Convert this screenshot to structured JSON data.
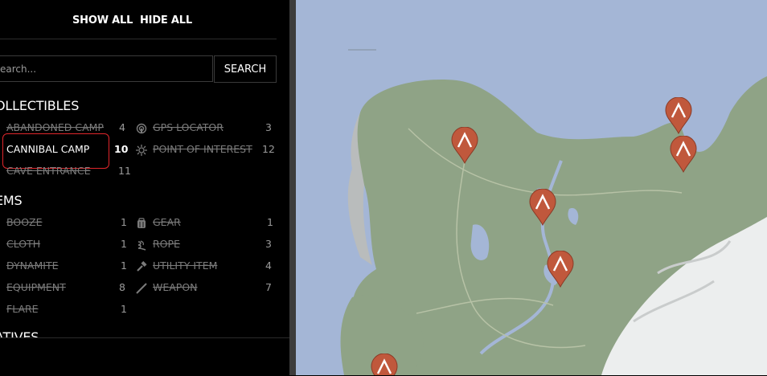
{
  "filter": {
    "show_all": "SHOW ALL",
    "hide_all": "HIDE ALL"
  },
  "search": {
    "placeholder": "earch...",
    "button": "SEARCH"
  },
  "sections": {
    "collectibles": "OLLECTIBLES",
    "items": "EMS",
    "natives": "ATIVES"
  },
  "collectibles": {
    "abandoned_camp": {
      "label": "ABANDONED CAMP",
      "count": "4"
    },
    "cannibal_camp": {
      "label": "CANNIBAL CAMP",
      "count": "10"
    },
    "cave_entrance": {
      "label": "CAVE ENTRANCE",
      "count": "11"
    },
    "gps_locator": {
      "label": "GPS LOCATOR",
      "count": "3"
    },
    "point_of_interest": {
      "label": "POINT OF INTEREST",
      "count": "12"
    }
  },
  "items": {
    "booze": {
      "label": "BOOZE",
      "count": "1"
    },
    "cloth": {
      "label": "CLOTH",
      "count": "1"
    },
    "dynamite": {
      "label": "DYNAMITE",
      "count": "1"
    },
    "equipment": {
      "label": "EQUIPMENT",
      "count": "8"
    },
    "flare": {
      "label": "FLARE",
      "count": "1"
    },
    "gear": {
      "label": "GEAR",
      "count": "1"
    },
    "rope": {
      "label": "ROPE",
      "count": "3"
    },
    "utility_item": {
      "label": "UTILITY ITEM",
      "count": "4"
    },
    "weapon": {
      "label": "WEAPON",
      "count": "7"
    }
  },
  "colors": {
    "marker": "#c0583c",
    "land": "#8fa386",
    "water": "#a4b6d6",
    "snow": "#eceeee",
    "highlight": "#e0262b"
  },
  "map_markers": [
    "cannibal-camp-marker",
    "cannibal-camp-marker",
    "cannibal-camp-marker",
    "cannibal-camp-marker",
    "cannibal-camp-marker",
    "cannibal-camp-marker"
  ]
}
